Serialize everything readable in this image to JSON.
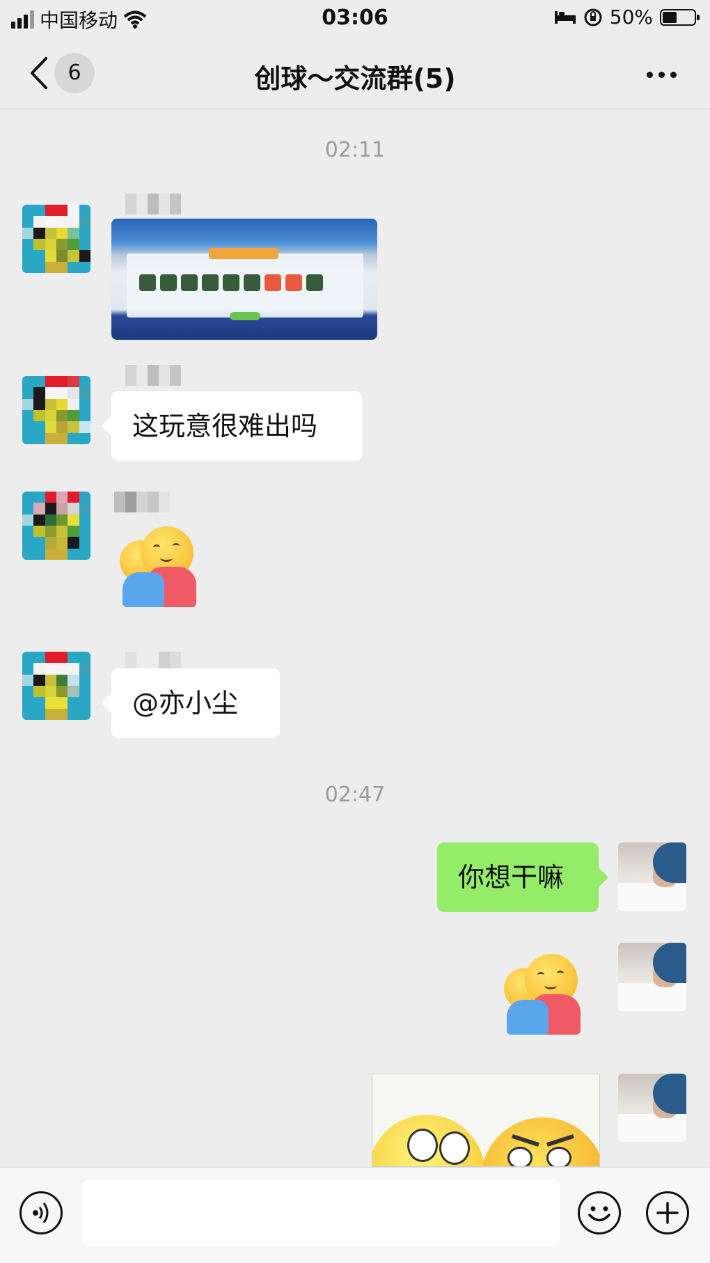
{
  "status": {
    "carrier": "中国移动",
    "time": "03:06",
    "battery": "50%",
    "battery_level": 0.5
  },
  "nav": {
    "badge": "6",
    "title": "创球～交流群(5)"
  },
  "timestamps": [
    "02:11",
    "02:47"
  ],
  "messages": [
    {
      "side": "left",
      "type": "image",
      "content": "game-screenshot"
    },
    {
      "side": "left",
      "type": "text",
      "text": "这玩意很难出吗"
    },
    {
      "side": "left",
      "type": "sticker",
      "content": "hug-emoji"
    },
    {
      "side": "left",
      "type": "text",
      "text": "@亦小尘"
    },
    {
      "side": "right",
      "type": "text",
      "text": "你想干嘛"
    },
    {
      "side": "right",
      "type": "sticker",
      "content": "hug-emoji"
    },
    {
      "side": "right",
      "type": "image",
      "content": "emoji-faces"
    }
  ],
  "colors": {
    "background": "#ededed",
    "self_bubble": "#95ec69",
    "other_bubble": "#ffffff"
  }
}
